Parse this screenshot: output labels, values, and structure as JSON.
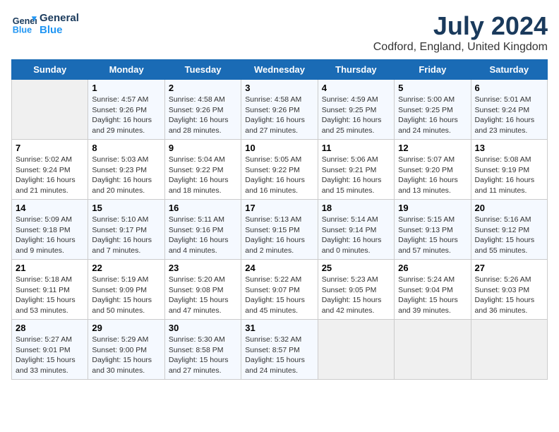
{
  "header": {
    "logo_line1": "General",
    "logo_line2": "Blue",
    "title": "July 2024",
    "subtitle": "Codford, England, United Kingdom"
  },
  "days_of_week": [
    "Sunday",
    "Monday",
    "Tuesday",
    "Wednesday",
    "Thursday",
    "Friday",
    "Saturday"
  ],
  "weeks": [
    [
      null,
      {
        "day": 1,
        "sunrise": "4:57 AM",
        "sunset": "9:26 PM",
        "daylight": "16 hours and 29 minutes."
      },
      {
        "day": 2,
        "sunrise": "4:58 AM",
        "sunset": "9:26 PM",
        "daylight": "16 hours and 28 minutes."
      },
      {
        "day": 3,
        "sunrise": "4:58 AM",
        "sunset": "9:26 PM",
        "daylight": "16 hours and 27 minutes."
      },
      {
        "day": 4,
        "sunrise": "4:59 AM",
        "sunset": "9:25 PM",
        "daylight": "16 hours and 25 minutes."
      },
      {
        "day": 5,
        "sunrise": "5:00 AM",
        "sunset": "9:25 PM",
        "daylight": "16 hours and 24 minutes."
      },
      {
        "day": 6,
        "sunrise": "5:01 AM",
        "sunset": "9:24 PM",
        "daylight": "16 hours and 23 minutes."
      }
    ],
    [
      {
        "day": 7,
        "sunrise": "5:02 AM",
        "sunset": "9:24 PM",
        "daylight": "16 hours and 21 minutes."
      },
      {
        "day": 8,
        "sunrise": "5:03 AM",
        "sunset": "9:23 PM",
        "daylight": "16 hours and 20 minutes."
      },
      {
        "day": 9,
        "sunrise": "5:04 AM",
        "sunset": "9:22 PM",
        "daylight": "16 hours and 18 minutes."
      },
      {
        "day": 10,
        "sunrise": "5:05 AM",
        "sunset": "9:22 PM",
        "daylight": "16 hours and 16 minutes."
      },
      {
        "day": 11,
        "sunrise": "5:06 AM",
        "sunset": "9:21 PM",
        "daylight": "16 hours and 15 minutes."
      },
      {
        "day": 12,
        "sunrise": "5:07 AM",
        "sunset": "9:20 PM",
        "daylight": "16 hours and 13 minutes."
      },
      {
        "day": 13,
        "sunrise": "5:08 AM",
        "sunset": "9:19 PM",
        "daylight": "16 hours and 11 minutes."
      }
    ],
    [
      {
        "day": 14,
        "sunrise": "5:09 AM",
        "sunset": "9:18 PM",
        "daylight": "16 hours and 9 minutes."
      },
      {
        "day": 15,
        "sunrise": "5:10 AM",
        "sunset": "9:17 PM",
        "daylight": "16 hours and 7 minutes."
      },
      {
        "day": 16,
        "sunrise": "5:11 AM",
        "sunset": "9:16 PM",
        "daylight": "16 hours and 4 minutes."
      },
      {
        "day": 17,
        "sunrise": "5:13 AM",
        "sunset": "9:15 PM",
        "daylight": "16 hours and 2 minutes."
      },
      {
        "day": 18,
        "sunrise": "5:14 AM",
        "sunset": "9:14 PM",
        "daylight": "16 hours and 0 minutes."
      },
      {
        "day": 19,
        "sunrise": "5:15 AM",
        "sunset": "9:13 PM",
        "daylight": "15 hours and 57 minutes."
      },
      {
        "day": 20,
        "sunrise": "5:16 AM",
        "sunset": "9:12 PM",
        "daylight": "15 hours and 55 minutes."
      }
    ],
    [
      {
        "day": 21,
        "sunrise": "5:18 AM",
        "sunset": "9:11 PM",
        "daylight": "15 hours and 53 minutes."
      },
      {
        "day": 22,
        "sunrise": "5:19 AM",
        "sunset": "9:09 PM",
        "daylight": "15 hours and 50 minutes."
      },
      {
        "day": 23,
        "sunrise": "5:20 AM",
        "sunset": "9:08 PM",
        "daylight": "15 hours and 47 minutes."
      },
      {
        "day": 24,
        "sunrise": "5:22 AM",
        "sunset": "9:07 PM",
        "daylight": "15 hours and 45 minutes."
      },
      {
        "day": 25,
        "sunrise": "5:23 AM",
        "sunset": "9:05 PM",
        "daylight": "15 hours and 42 minutes."
      },
      {
        "day": 26,
        "sunrise": "5:24 AM",
        "sunset": "9:04 PM",
        "daylight": "15 hours and 39 minutes."
      },
      {
        "day": 27,
        "sunrise": "5:26 AM",
        "sunset": "9:03 PM",
        "daylight": "15 hours and 36 minutes."
      }
    ],
    [
      {
        "day": 28,
        "sunrise": "5:27 AM",
        "sunset": "9:01 PM",
        "daylight": "15 hours and 33 minutes."
      },
      {
        "day": 29,
        "sunrise": "5:29 AM",
        "sunset": "9:00 PM",
        "daylight": "15 hours and 30 minutes."
      },
      {
        "day": 30,
        "sunrise": "5:30 AM",
        "sunset": "8:58 PM",
        "daylight": "15 hours and 27 minutes."
      },
      {
        "day": 31,
        "sunrise": "5:32 AM",
        "sunset": "8:57 PM",
        "daylight": "15 hours and 24 minutes."
      },
      null,
      null,
      null
    ]
  ],
  "labels": {
    "sunrise_label": "Sunrise:",
    "sunset_label": "Sunset:",
    "daylight_label": "Daylight:"
  }
}
